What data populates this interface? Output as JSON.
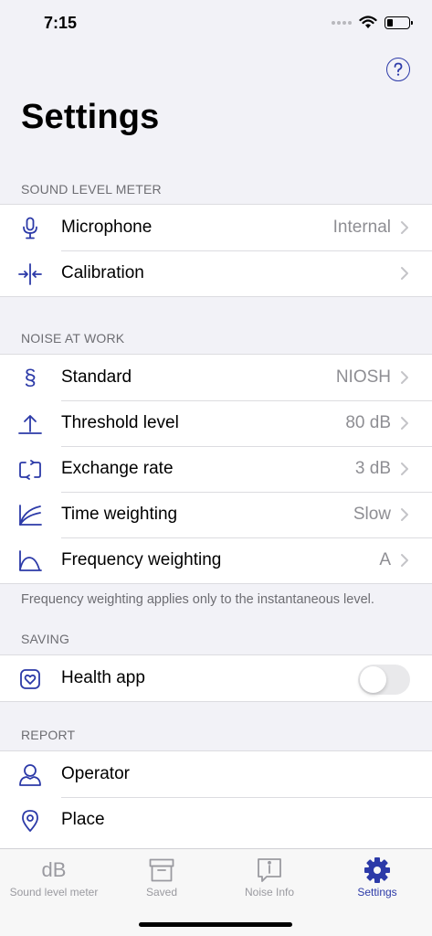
{
  "status_bar": {
    "time": "7:15"
  },
  "header": {
    "help_icon": "question-circle-icon",
    "title": "Settings"
  },
  "sections": {
    "sound_level_meter": {
      "header": "SOUND LEVEL METER",
      "rows": [
        {
          "label": "Microphone",
          "value": "Internal",
          "icon": "microphone-icon"
        },
        {
          "label": "Calibration",
          "value": "",
          "icon": "calibration-icon"
        }
      ]
    },
    "noise_at_work": {
      "header": "NOISE AT WORK",
      "rows": [
        {
          "label": "Standard",
          "value": "NIOSH",
          "icon": "section-sign-icon"
        },
        {
          "label": "Threshold level",
          "value": "80 dB",
          "icon": "threshold-arrow-icon"
        },
        {
          "label": "Exchange rate",
          "value": "3 dB",
          "icon": "exchange-icon"
        },
        {
          "label": "Time weighting",
          "value": "Slow",
          "icon": "time-curve-icon"
        },
        {
          "label": "Frequency weighting",
          "value": "A",
          "icon": "frequency-curve-icon"
        }
      ],
      "footnote": "Frequency weighting applies only to the instantaneous level."
    },
    "saving": {
      "header": "SAVING",
      "rows": [
        {
          "label": "Health app",
          "icon": "health-heart-icon",
          "toggle_on": false
        }
      ]
    },
    "report": {
      "header": "REPORT",
      "rows": [
        {
          "label": "Operator",
          "icon": "person-icon"
        },
        {
          "label": "Place",
          "icon": "location-pin-icon"
        }
      ]
    }
  },
  "tab_bar": {
    "tabs": [
      {
        "label": "Sound level meter",
        "icon_text": "dB",
        "icon": "db-icon",
        "active": false
      },
      {
        "label": "Saved",
        "icon": "archive-box-icon",
        "active": false
      },
      {
        "label": "Noise Info",
        "icon": "info-bubble-icon",
        "active": false
      },
      {
        "label": "Settings",
        "icon": "gear-icon",
        "active": true
      }
    ]
  },
  "colors": {
    "accent": "#2c3aa8",
    "background": "#f2f2f7",
    "secondary_text": "#8e8e93"
  }
}
